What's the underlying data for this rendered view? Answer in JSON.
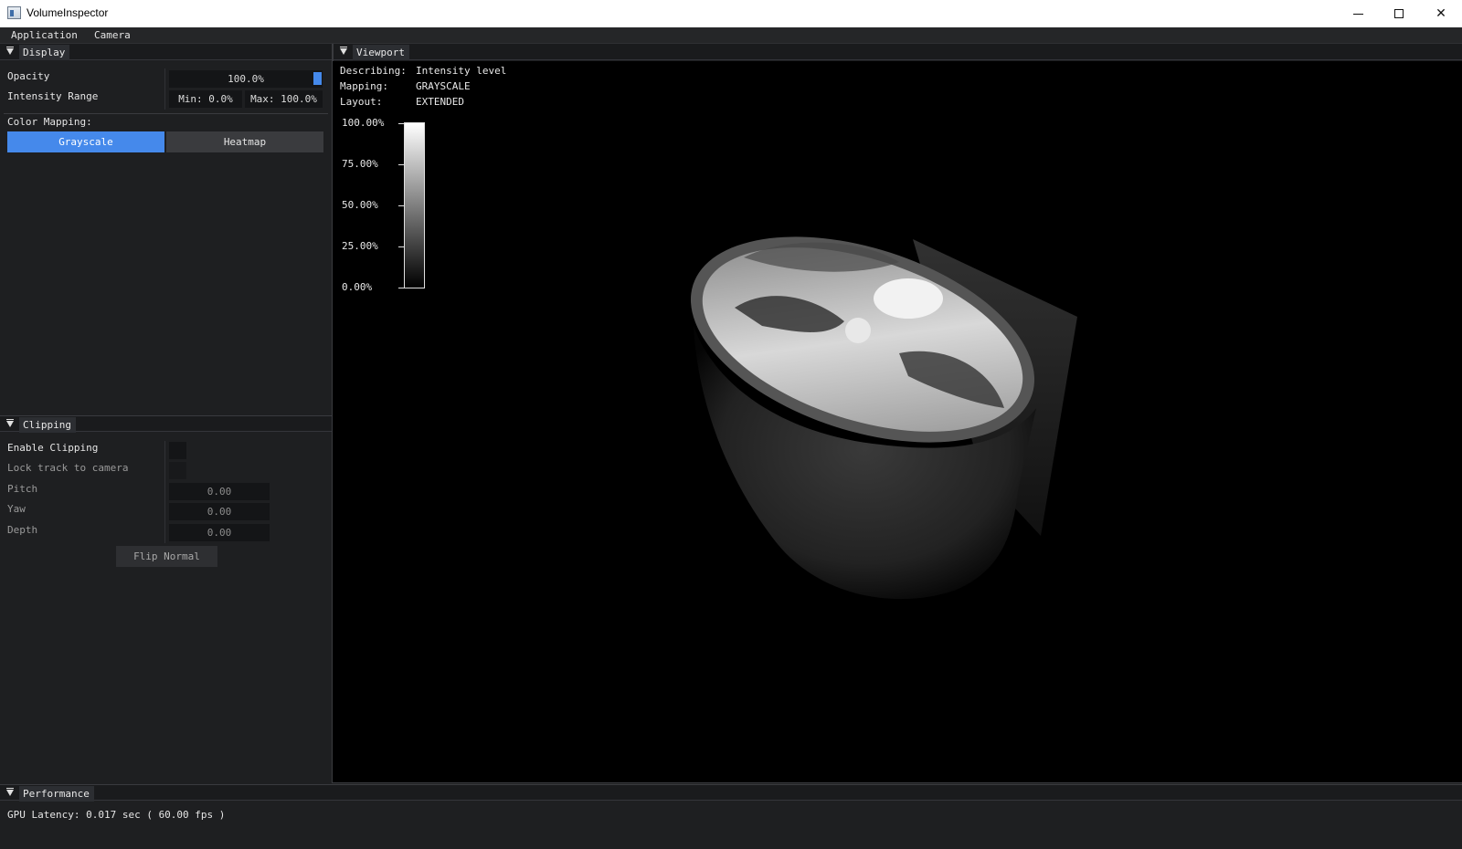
{
  "window": {
    "title": "VolumeInspector"
  },
  "menu": {
    "items": [
      "Application",
      "Camera"
    ]
  },
  "display": {
    "tab": "Display",
    "opacity_label": "Opacity",
    "opacity_value": "100.0%",
    "opacity_fraction": 1.0,
    "intensity_label": "Intensity Range",
    "intensity_min": "Min: 0.0%",
    "intensity_max": "Max: 100.0%",
    "color_mapping_label": "Color Mapping:",
    "mapping_options": [
      "Grayscale",
      "Heatmap"
    ],
    "mapping_selected": "Grayscale",
    "accent_color": "#4589eb"
  },
  "clipping": {
    "tab": "Clipping",
    "enable_label": "Enable Clipping",
    "enable_checked": false,
    "lock_label": "Lock track to camera",
    "lock_checked": false,
    "pitch_label": "Pitch",
    "pitch_value": "0.00",
    "yaw_label": "Yaw",
    "yaw_value": "0.00",
    "depth_label": "Depth",
    "depth_value": "0.00",
    "flip_button": "Flip Normal"
  },
  "viewport": {
    "tab": "Viewport",
    "describing_key": "Describing:",
    "describing_value": "Intensity level",
    "mapping_key": "Mapping:",
    "mapping_value": "GRAYSCALE",
    "layout_key": "Layout:",
    "layout_value": "EXTENDED",
    "legend_ticks": [
      "100.00%",
      "75.00%",
      "50.00%",
      "25.00%",
      "0.00%"
    ]
  },
  "performance": {
    "tab": "Performance",
    "gpu_latency": "GPU Latency: 0.017 sec ( 60.00 fps )"
  }
}
